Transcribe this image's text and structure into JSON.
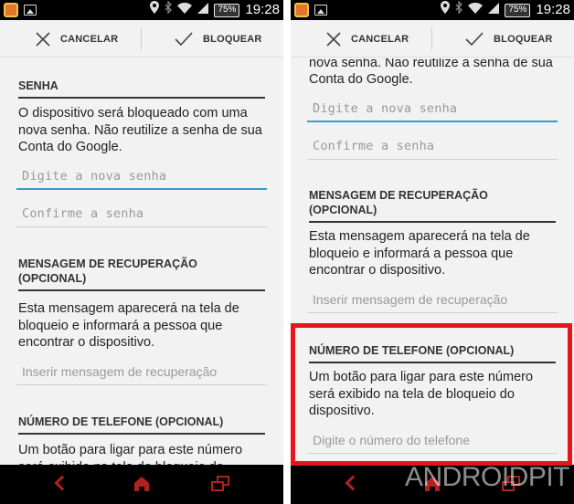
{
  "status_bar": {
    "battery": "75%",
    "time": "19:28"
  },
  "action_bar": {
    "cancel_label": "CANCELAR",
    "block_label": "BLOQUEAR"
  },
  "password_section": {
    "title": "SENHA",
    "description": "O dispositivo será bloqueado com uma nova senha. Não reutilize a senha de sua Conta do Google.",
    "new_password_placeholder": "Digite a nova senha",
    "confirm_password_placeholder": "Confirme a senha"
  },
  "recovery_section": {
    "title": "MENSAGEM DE RECUPERAÇÃO (OPCIONAL)",
    "description": "Esta mensagem aparecerá na tela de bloqueio e informará a pessoa que encontrar o dispositivo.",
    "input_placeholder": "Inserir mensagem de recuperação"
  },
  "phone_section": {
    "title": "NÚMERO DE TELEFONE (OPCIONAL)",
    "description": "Um botão para ligar para este número será exibido na tela de bloqueio do dispositivo.",
    "input_placeholder": "Digite o número do telefone"
  },
  "watermark": "ANDROIDPIT",
  "colors": {
    "highlight": "#e8141b",
    "focus_underline": "#3a9bd0",
    "nav_icons": "#b0211f"
  },
  "icons": [
    "app-icon",
    "image-icon",
    "location-icon",
    "bluetooth-icon",
    "wifi-icon",
    "signal-icon",
    "battery-icon",
    "close-icon",
    "check-icon",
    "back-icon",
    "home-icon",
    "recent-apps-icon"
  ]
}
